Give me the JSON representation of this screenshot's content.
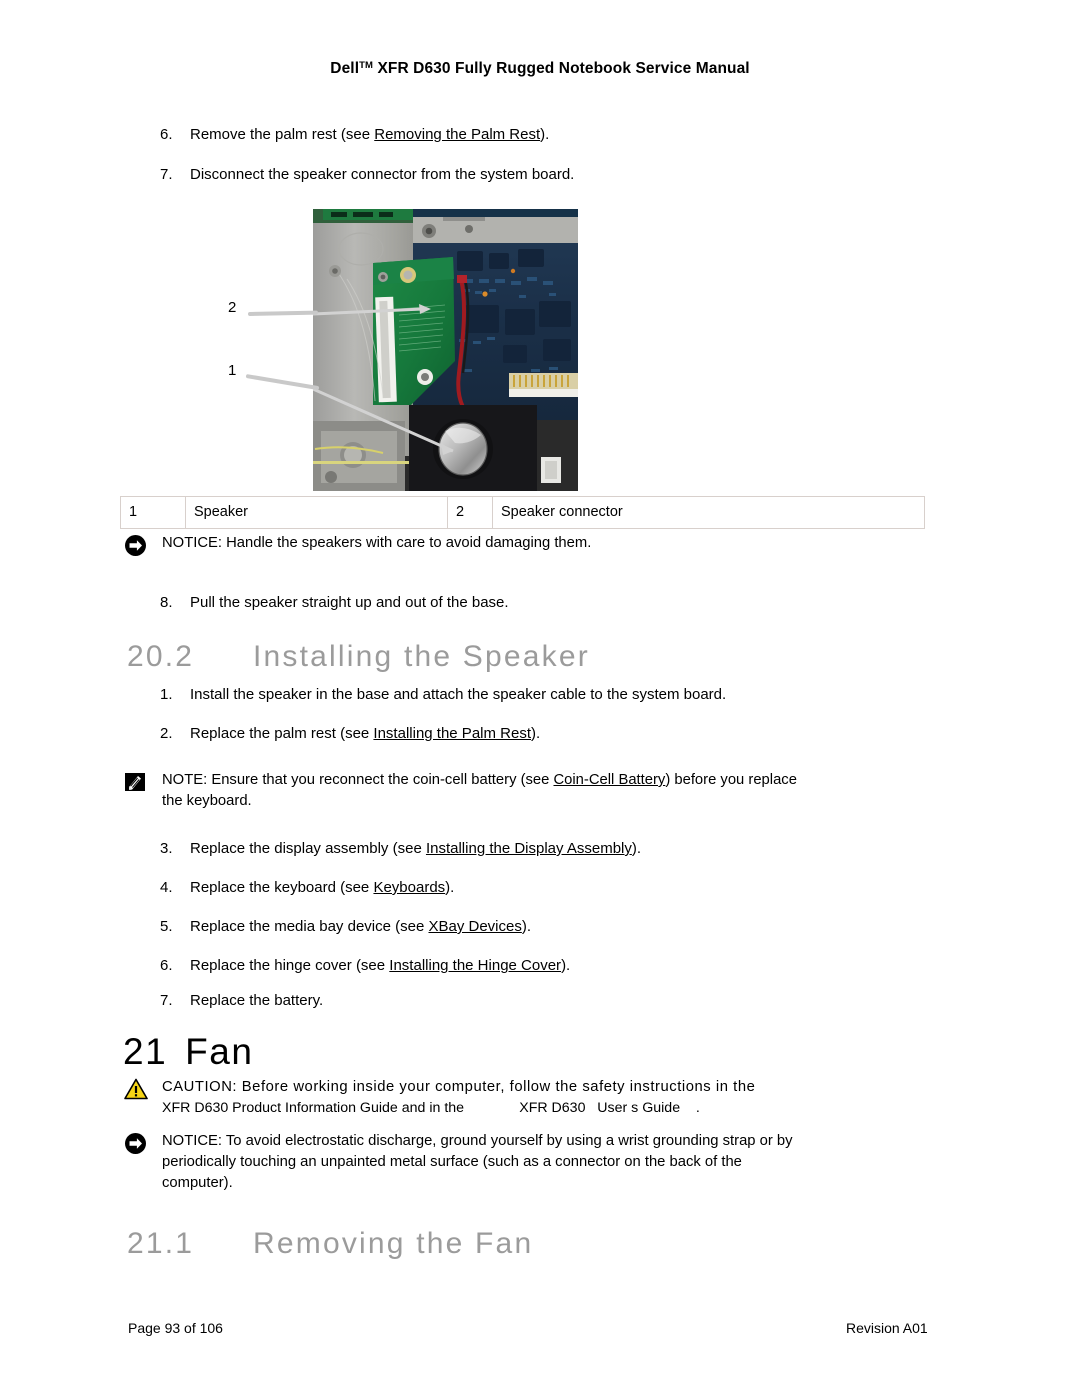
{
  "header": {
    "title_prefix": "Dell",
    "title_sup": "TM",
    "title_rest": " XFR D630 Fully Rugged Notebook Service Manual"
  },
  "removal_steps": [
    {
      "num": "6.",
      "pre": "Remove the palm rest (see ",
      "link": "Removing the Palm Rest",
      "post": ")."
    },
    {
      "num": "7.",
      "pre": "Disconnect the speaker connector from the system board.",
      "link": "",
      "post": ""
    }
  ],
  "figure": {
    "callouts": [
      {
        "label": "2"
      },
      {
        "label": "1"
      }
    ],
    "legend": {
      "rows": [
        {
          "idx": "1",
          "label": "Speaker",
          "idx2": "2",
          "label2": "Speaker connector"
        }
      ]
    }
  },
  "notice_1": {
    "icon": "notice-arrow-icon",
    "lines": [
      "NOTICE: Handle the speakers with care to avoid damaging them."
    ]
  },
  "step_8": {
    "num": "8.",
    "pre": "Pull the speaker straight up and out of the base.",
    "link": "",
    "post": ""
  },
  "heading_20_2": {
    "number": "20.2",
    "text": "Installing the Speaker"
  },
  "install_steps_a": [
    {
      "num": "1.",
      "pre": "Install the speaker in the base and attach the speaker cable to the system board.",
      "link": "",
      "post": ""
    },
    {
      "num": "2.",
      "pre": "Replace the palm rest (see ",
      "link": "Installing the Palm Rest",
      "post": ")."
    }
  ],
  "note_1": {
    "icon": "note-pencil-icon",
    "line1_pre": "NOTE: Ensure that you reconnect the coin-cell battery (see ",
    "line1_link": "Coin-Cell Battery",
    "line1_post": ") before you replace",
    "line2": "the keyboard."
  },
  "install_steps_b": [
    {
      "num": "3.",
      "pre": "Replace the display assembly (see ",
      "link": "Installing the Display Assembly",
      "post": ")."
    },
    {
      "num": "4.",
      "pre": "Replace the keyboard (see ",
      "link": "Keyboards",
      "post": ")."
    },
    {
      "num": "5.",
      "pre": "Replace the media bay device (see ",
      "link": "XBay Devices",
      "post": ")."
    },
    {
      "num": "6.",
      "pre": "Replace the hinge cover (see ",
      "link": "Installing the Hinge Cover",
      "post": ")."
    },
    {
      "num": "7.",
      "pre": "Replace the battery.",
      "link": "",
      "post": ""
    }
  ],
  "heading_21": {
    "number": "21",
    "text": "Fan"
  },
  "caution_1": {
    "icon": "caution-triangle-icon",
    "line1": "CAUTION: Before working inside your computer, follow the safety instructions in the",
    "line2": "XFR D630 Product Information Guide and in the              XFR D630   User s Guide    ."
  },
  "notice_2": {
    "icon": "notice-arrow-icon",
    "lines": [
      "NOTICE: To avoid electrostatic discharge, ground yourself by using a wrist grounding strap or by",
      "periodically touching an unpainted metal surface (such as a connector on the back of the",
      "computer)."
    ]
  },
  "heading_21_1": {
    "number": "21.1",
    "text": "Removing the Fan"
  },
  "footer": {
    "page": "Page 93 of 106",
    "revision": "Revision A01"
  },
  "colors": {
    "heading_gray": "#9b9b9b",
    "caution_yellow": "#f5d416",
    "table_border": "#d8d0cc"
  }
}
